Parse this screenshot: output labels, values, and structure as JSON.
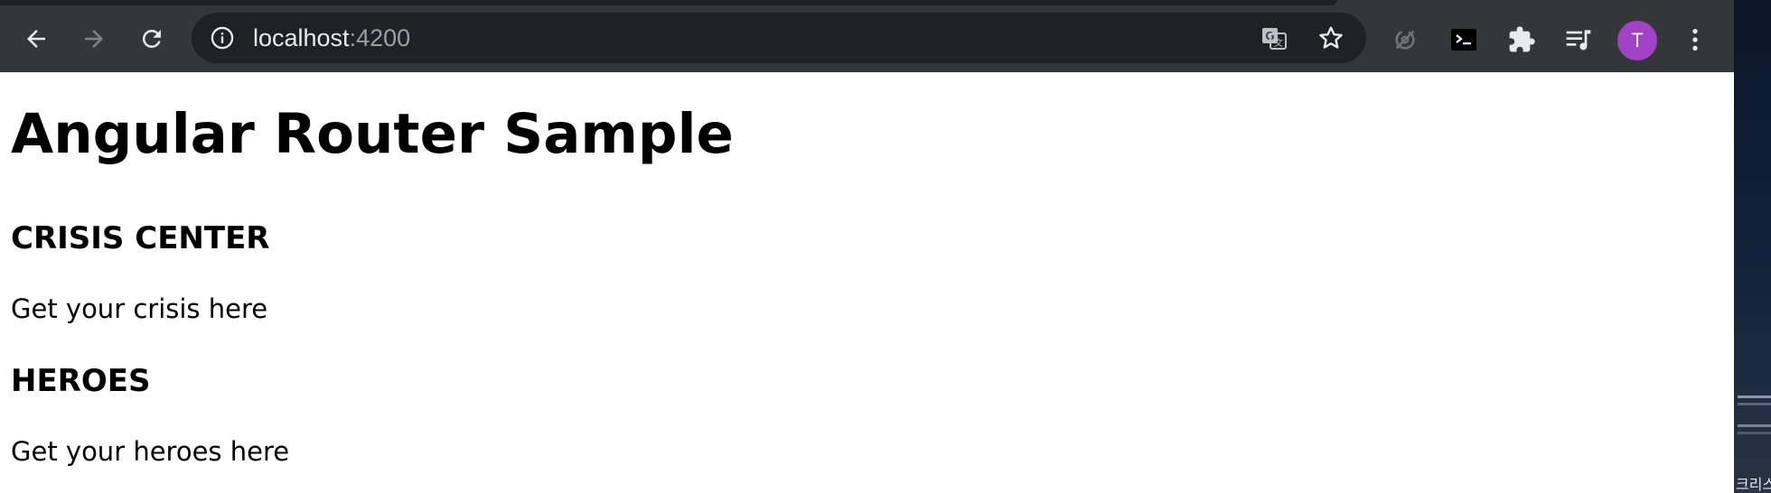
{
  "browser": {
    "toolbar": {
      "back_icon": "arrow-left-icon",
      "forward_icon": "arrow-right-icon",
      "reload_icon": "reload-icon",
      "omnibox": {
        "host": "localhost",
        "port": ":4200",
        "info_icon": "info-circle-icon",
        "translate_icon": "translate-icon",
        "bookmark_icon": "star-icon"
      },
      "extensions": [
        "sync-disabled-icon",
        "terminal-icon",
        "puzzle-icon",
        "reading-list-icon"
      ],
      "profile_initial": "T",
      "profile_color": "#a142c7",
      "menu_icon": "kebab-menu-icon"
    }
  },
  "page": {
    "title": "Angular Router Sample",
    "sections": [
      {
        "heading": "CRISIS CENTER",
        "text": "Get your crisis here"
      },
      {
        "heading": "HEROES",
        "text": "Get your heroes here"
      }
    ]
  },
  "desktop": {
    "label": "크리스"
  }
}
